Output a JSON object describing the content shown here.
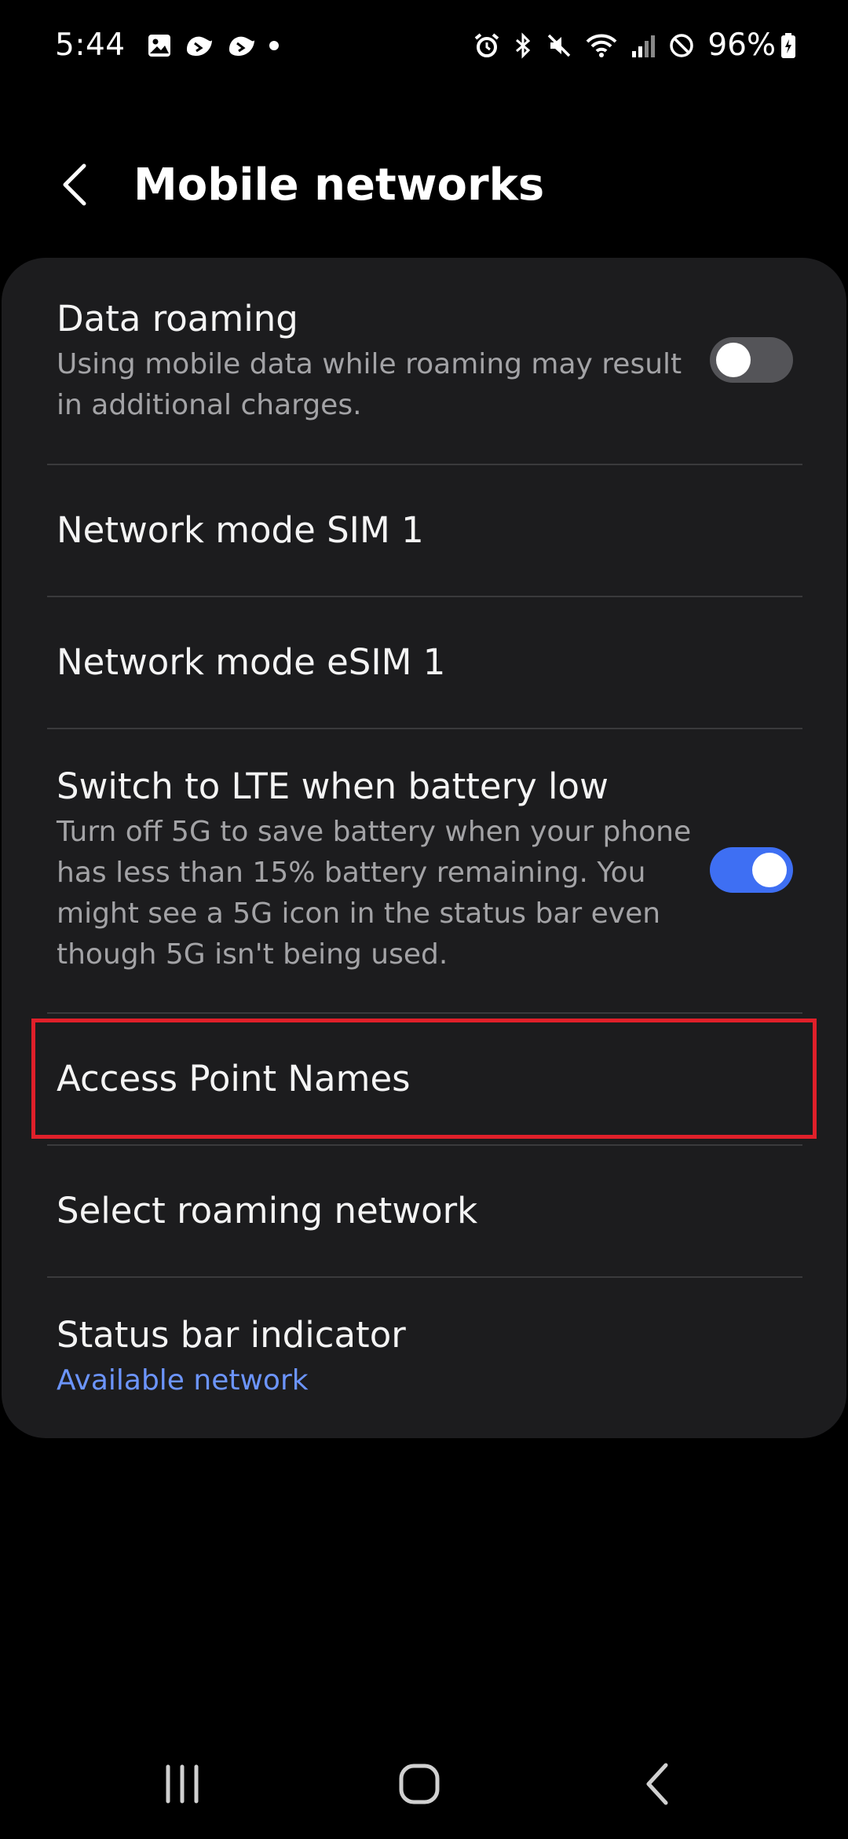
{
  "status_bar": {
    "time": "5:44",
    "battery": "96%",
    "left_icons": [
      "gallery-icon",
      "threads-icon",
      "threads-icon",
      "dot-icon"
    ],
    "right_icons": [
      "alarm-icon",
      "bluetooth-icon",
      "mute-icon",
      "wifi-icon",
      "signal-icon",
      "dnd-icon",
      "battery-icon"
    ]
  },
  "header": {
    "title": "Mobile networks",
    "back_icon": "chevron-left-icon"
  },
  "settings": {
    "data_roaming": {
      "title": "Data roaming",
      "subtitle": "Using mobile data while roaming may result in additional charges.",
      "enabled": false
    },
    "network_mode_sim1": {
      "title": "Network mode SIM 1"
    },
    "network_mode_esim1": {
      "title": "Network mode eSIM 1"
    },
    "switch_lte": {
      "title": "Switch to LTE when battery low",
      "subtitle": "Turn off 5G to save battery when your phone has less than 15% battery remaining. You might see a 5G icon in the status bar even though 5G isn't being used.",
      "enabled": true
    },
    "access_point_names": {
      "title": "Access Point Names",
      "highlighted": true
    },
    "select_roaming_network": {
      "title": "Select roaming network"
    },
    "status_bar_indicator": {
      "title": "Status bar indicator",
      "value": "Available network"
    }
  },
  "colors": {
    "background": "#000000",
    "card": "#1c1c1e",
    "accent": "#3e6ff3",
    "accent_text": "#6c95ff",
    "highlight": "#e0202a"
  },
  "nav_bar": {
    "recents_icon": "recents-icon",
    "home_icon": "home-icon",
    "back_icon": "back-icon"
  }
}
